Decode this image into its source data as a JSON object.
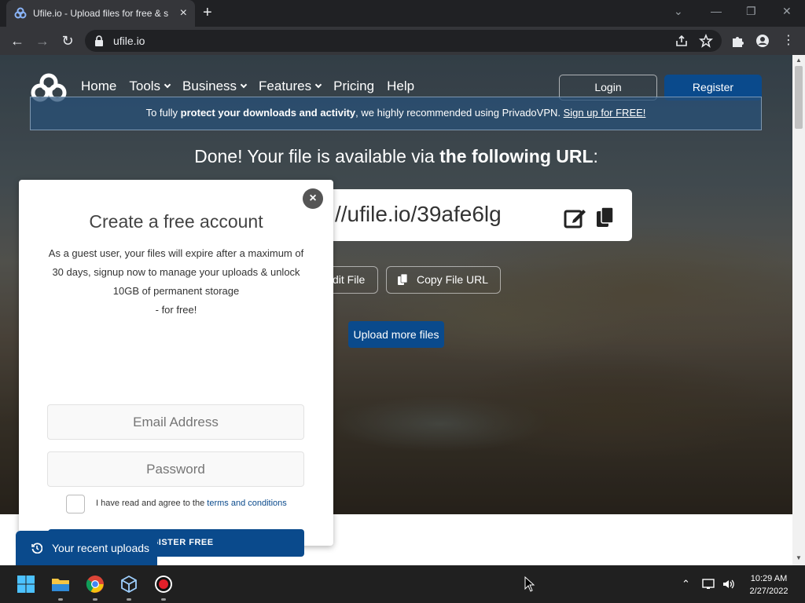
{
  "browser": {
    "tab_title": "Ufile.io - Upload files for free & s",
    "url": "ufile.io"
  },
  "site": {
    "nav": [
      {
        "label": "Home",
        "dropdown": false
      },
      {
        "label": "Tools",
        "dropdown": true
      },
      {
        "label": "Business",
        "dropdown": true
      },
      {
        "label": "Features",
        "dropdown": true
      },
      {
        "label": "Pricing",
        "dropdown": false
      },
      {
        "label": "Help",
        "dropdown": false
      }
    ],
    "login_label": "Login",
    "register_label": "Register",
    "vpn": {
      "text1": "To fully ",
      "bold": "protect your downloads and activity",
      "text2": ", we highly recommended using PrivadoVPN. ",
      "link": "Sign up for FREE!"
    },
    "done_title": {
      "prefix": "Done! Your file is available via ",
      "bold": "the following URL",
      "suffix": ":"
    },
    "file_url": "//ufile.io/39afe6lg",
    "edit_file_label": "dit File",
    "copy_url_label": "Copy File URL",
    "upload_more_label": "Upload more files",
    "recent_uploads_label": "Your recent uploads"
  },
  "modal": {
    "close_label": "×",
    "title": "Create a free account",
    "description_lines": [
      "As a guest user, your files will expire after a maximum of",
      "30 days, signup now to manage your uploads & unlock",
      "10GB of permanent storage",
      "- for free!"
    ],
    "email_placeholder": "Email Address",
    "password_placeholder": "Password",
    "terms_text": "I have read and agree to the ",
    "terms_link": "terms and conditions",
    "submit_label": "REGISTER FREE"
  },
  "taskbar": {
    "time": "10:29 AM",
    "date": "2/27/2022"
  },
  "colors": {
    "brand_blue": "#0a4a8c",
    "chrome_dark": "#202124",
    "chrome_toolbar": "#35363a"
  }
}
